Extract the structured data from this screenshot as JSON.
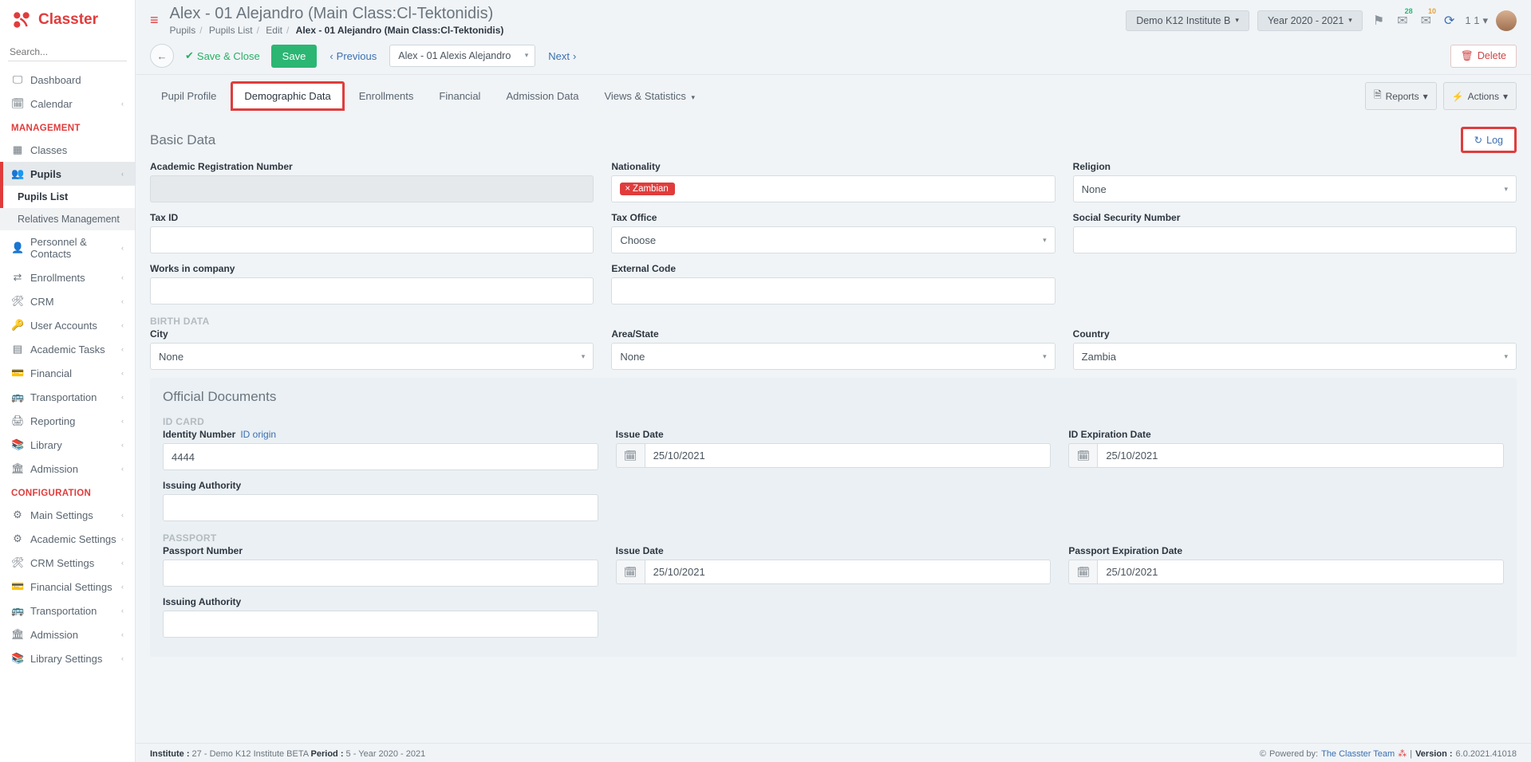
{
  "brand": "Classter",
  "search_placeholder": "Search...",
  "nav": {
    "dashboard": "Dashboard",
    "calendar": "Calendar",
    "heading_mgmt": "MANAGEMENT",
    "classes": "Classes",
    "pupils": "Pupils",
    "pupils_list": "Pupils List",
    "relatives": "Relatives Management",
    "personnel": "Personnel & Contacts",
    "enrollments": "Enrollments",
    "crm": "CRM",
    "user_accounts": "User Accounts",
    "academic_tasks": "Academic Tasks",
    "financial": "Financial",
    "transportation": "Transportation",
    "reporting": "Reporting",
    "library": "Library",
    "admission": "Admission",
    "heading_conf": "CONFIGURATION",
    "main_settings": "Main Settings",
    "academic_settings": "Academic Settings",
    "crm_settings": "CRM Settings",
    "financial_settings": "Financial Settings",
    "transportation2": "Transportation",
    "admission2": "Admission",
    "library_settings": "Library Settings"
  },
  "header": {
    "title": "Alex - 01 Alejandro (Main Class:Cl-Tektonidis)",
    "crumb_pupils": "Pupils",
    "crumb_list": "Pupils List",
    "crumb_edit": "Edit",
    "crumb_cur": "Alex - 01 Alejandro (Main Class:Cl-Tektonidis)",
    "institute": "Demo K12 Institute B",
    "year": "Year 2020 - 2021",
    "badge28": "28",
    "badge10": "10",
    "oneone": "1 1"
  },
  "actions": {
    "save_close": "Save & Close",
    "save": "Save",
    "previous": "Previous",
    "nav_select": "Alex - 01 Alexis Alejandro",
    "next": "Next",
    "delete": "Delete"
  },
  "tabs": {
    "profile": "Pupil Profile",
    "demo": "Demographic Data",
    "enroll": "Enrollments",
    "fin": "Financial",
    "adm": "Admission Data",
    "views": "Views & Statistics",
    "reports": "Reports",
    "actions": "Actions"
  },
  "panel": {
    "basic": "Basic Data",
    "log": "Log",
    "official": "Official Documents"
  },
  "labels": {
    "reg_no": "Academic Registration Number",
    "nationality": "Nationality",
    "religion": "Religion",
    "tax_id": "Tax ID",
    "tax_office": "Tax Office",
    "ssn": "Social Security Number",
    "works": "Works in company",
    "ext_code": "External Code",
    "birth": "BIRTH DATA",
    "city": "City",
    "area": "Area/State",
    "country": "Country",
    "idcard": "ID CARD",
    "id_no": "Identity Number",
    "id_origin": "ID origin",
    "issue_date": "Issue Date",
    "id_exp": "ID Expiration Date",
    "issuing": "Issuing Authority",
    "passport": "PASSPORT",
    "pass_no": "Passport Number",
    "pass_exp": "Passport Expiration Date"
  },
  "vals": {
    "nationality_tag": "Zambian",
    "religion": "None",
    "tax_office": "Choose",
    "city": "None",
    "area": "None",
    "country": "Zambia",
    "id_no": "4444",
    "date": "25/10/2021"
  },
  "footer": {
    "inst_l": "Institute :",
    "inst_v": " 27 - Demo K12 Institute BETA ",
    "per_l": "Period :",
    "per_v": " 5 - Year 2020 - 2021",
    "power": "Powered by: ",
    "team": "The Classter Team",
    "ver_l": "Version :",
    "ver_v": " 6.0.2021.41018"
  }
}
